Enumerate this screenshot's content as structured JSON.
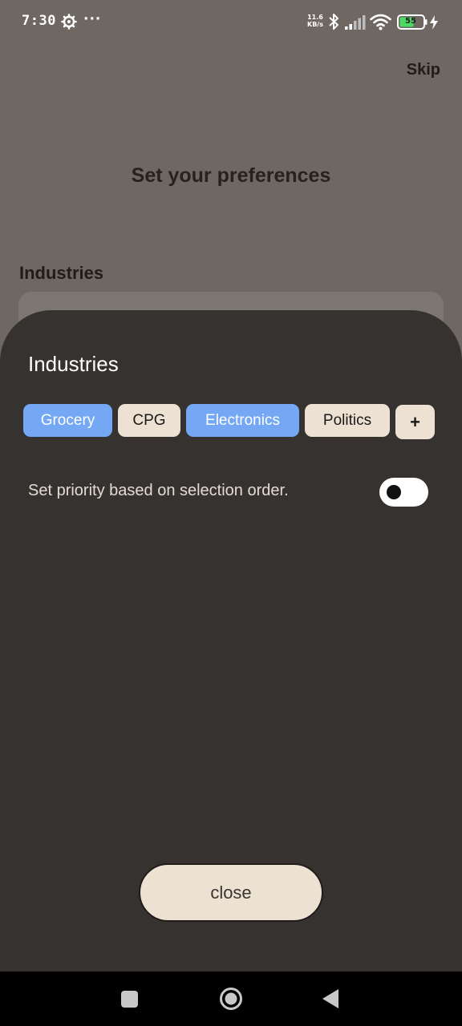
{
  "status_bar": {
    "time": "7:30",
    "more_indicator": "···",
    "network_speed_value": "11.6",
    "network_speed_unit": "KB/s",
    "battery_level": "55",
    "icons": [
      "gear-icon",
      "bluetooth-icon",
      "signal-icon",
      "wifi-icon",
      "battery-icon",
      "charging-icon"
    ]
  },
  "page": {
    "skip_label": "Skip",
    "title": "Set your preferences",
    "section_label": "Industries"
  },
  "sheet": {
    "title": "Industries",
    "chips": [
      {
        "label": "Grocery",
        "selected": true
      },
      {
        "label": "CPG",
        "selected": false
      },
      {
        "label": "Electronics",
        "selected": true
      },
      {
        "label": "Politics",
        "selected": false
      }
    ],
    "add_label": "+",
    "priority_label": "Set priority based on selection order.",
    "priority_toggle_on": false,
    "close_label": "close"
  },
  "colors": {
    "chip_selected": "#74a8f5",
    "chip_default": "#ece1d2",
    "sheet_background": "#36322f",
    "page_background": "#6f6862"
  },
  "nav_bar": {
    "icons": [
      "recents-square-icon",
      "home-circle-icon",
      "back-triangle-icon"
    ]
  }
}
